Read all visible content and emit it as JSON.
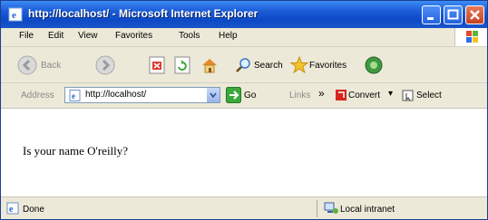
{
  "window": {
    "title": "http://localhost/ - Microsoft Internet Explorer"
  },
  "menu": [
    "File",
    "Edit",
    "View",
    "Favorites",
    "Tools",
    "Help"
  ],
  "toolbar": {
    "back_label": "Back",
    "search_label": "Search",
    "favorites_label": "Favorites"
  },
  "address": {
    "label": "Address",
    "url": "http://localhost/",
    "go_label": "Go",
    "links_label": "Links",
    "convert_label": "Convert",
    "select_label": "Select"
  },
  "content": {
    "text": "Is your name O'reilly?"
  },
  "status": {
    "left": "Done",
    "zone": "Local intranet"
  },
  "colors": {
    "titlebar": "#0b49c6",
    "chrome": "#ece9d8"
  },
  "icons": [
    "ie-icon",
    "minimize-icon",
    "maximize-icon",
    "close-icon",
    "windows-logo-icon",
    "back-icon",
    "forward-icon",
    "stop-icon",
    "refresh-icon",
    "home-icon",
    "search-icon",
    "favorites-star-icon",
    "media-icon",
    "page-icon",
    "go-arrow-icon",
    "convert-icon",
    "select-icon",
    "done-icon",
    "intranet-icon"
  ]
}
